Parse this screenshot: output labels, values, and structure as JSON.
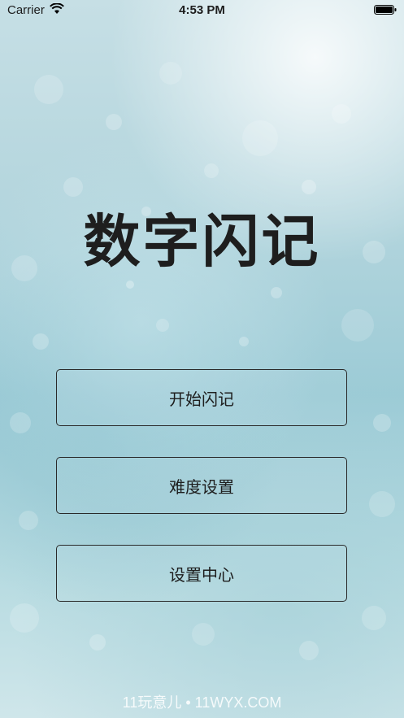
{
  "status_bar": {
    "carrier": "Carrier",
    "time": "4:53 PM"
  },
  "app": {
    "title": "数字闪记"
  },
  "menu": {
    "start_label": "开始闪记",
    "difficulty_label": "难度设置",
    "settings_label": "设置中心"
  },
  "watermark": {
    "text": "11玩意儿 • 11WYX.COM"
  },
  "colors": {
    "text": "#1e1e1e",
    "button_border": "#2a2a2a",
    "background_top": "#c6dfe5",
    "background_mid": "#9ccbd6"
  },
  "icons": {
    "wifi": "wifi-icon",
    "battery": "battery-icon"
  }
}
